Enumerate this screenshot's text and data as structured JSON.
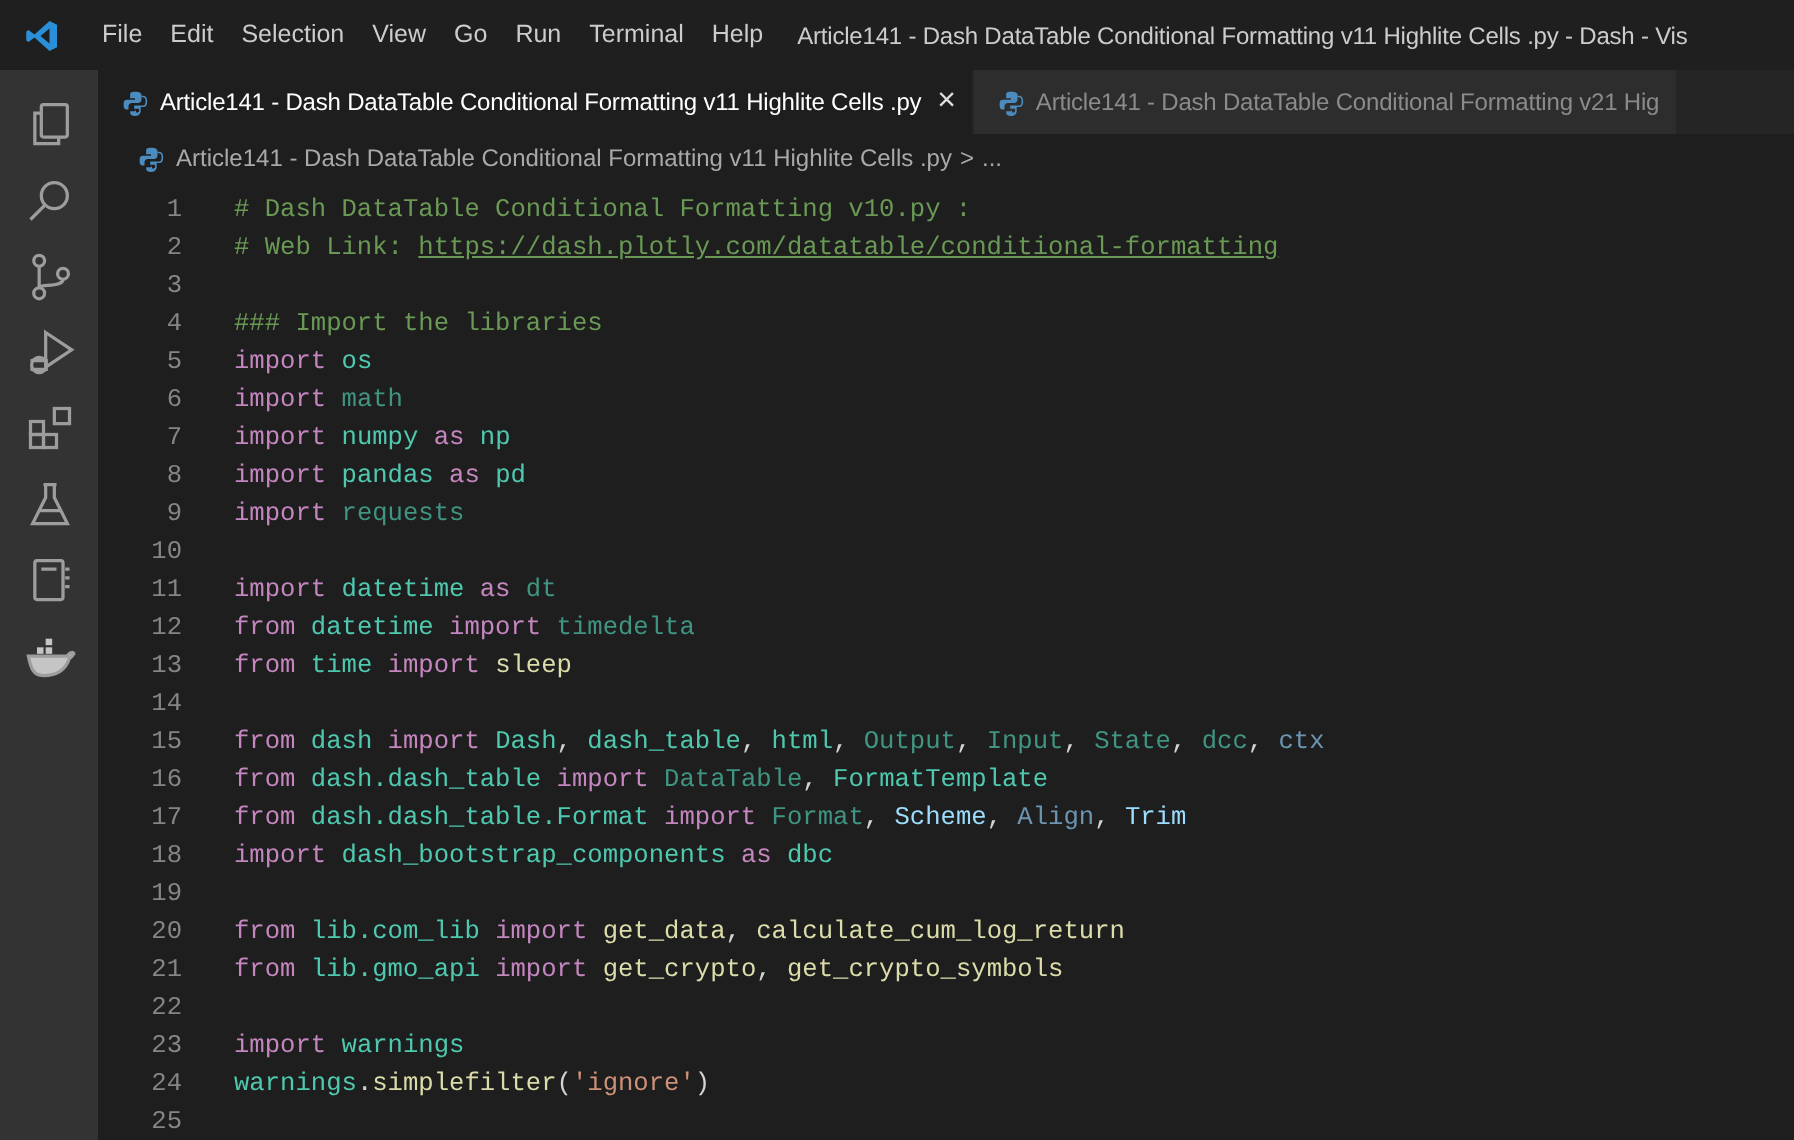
{
  "title_bar": {
    "menu": [
      "File",
      "Edit",
      "Selection",
      "View",
      "Go",
      "Run",
      "Terminal",
      "Help"
    ],
    "title": "Article141 - Dash DataTable Conditional Formatting v11 Highlite Cells .py - Dash - Vis"
  },
  "tabs": [
    {
      "label": "Article141 - Dash DataTable Conditional Formatting v11 Highlite Cells .py",
      "selected": true,
      "close": "×"
    },
    {
      "label": "Article141 - Dash DataTable Conditional Formatting v21 Hig",
      "selected": false
    }
  ],
  "breadcrumb": {
    "file": "Article141 - Dash DataTable Conditional Formatting v11 Highlite Cells .py",
    "separator": ">",
    "more": "..."
  },
  "code": [
    {
      "number": "1",
      "tokens": [
        {
          "kind": "comment",
          "text": "# Dash DataTable Conditional Formatting v10.py :"
        }
      ]
    },
    {
      "number": "2",
      "tokens": [
        {
          "kind": "comment",
          "text": "# Web Link: "
        },
        {
          "kind": "link",
          "text": "https://dash.plotly.com/datatable/conditional-formatting"
        }
      ]
    },
    {
      "number": "3"
    },
    {
      "number": "4",
      "tokens": [
        {
          "kind": "comment",
          "text": "### Import the libraries"
        }
      ]
    },
    {
      "number": "5",
      "tokens": [
        {
          "kind": "keyword",
          "text": "import "
        },
        {
          "kind": "module",
          "text": "os"
        }
      ]
    },
    {
      "number": "6",
      "tokens": [
        {
          "kind": "keyword",
          "text": "import "
        },
        {
          "kind": "dim",
          "text": "math"
        }
      ]
    },
    {
      "number": "7",
      "tokens": [
        {
          "kind": "keyword",
          "text": "import "
        },
        {
          "kind": "module",
          "text": "numpy"
        },
        {
          "kind": "keyword",
          "text": " as "
        },
        {
          "kind": "module",
          "text": "np"
        }
      ]
    },
    {
      "number": "8",
      "tokens": [
        {
          "kind": "keyword",
          "text": "import "
        },
        {
          "kind": "module",
          "text": "pandas"
        },
        {
          "kind": "keyword",
          "text": " as "
        },
        {
          "kind": "module",
          "text": "pd"
        }
      ]
    },
    {
      "number": "9",
      "tokens": [
        {
          "kind": "keyword",
          "text": "import "
        },
        {
          "kind": "dim",
          "text": "requests"
        }
      ]
    },
    {
      "number": "10"
    },
    {
      "number": "11",
      "tokens": [
        {
          "kind": "keyword",
          "text": "import "
        },
        {
          "kind": "module",
          "text": "datetime"
        },
        {
          "kind": "keyword",
          "text": " as "
        },
        {
          "kind": "dim",
          "text": "dt"
        }
      ]
    },
    {
      "number": "12",
      "tokens": [
        {
          "kind": "keyword",
          "text": "from "
        },
        {
          "kind": "module",
          "text": "datetime"
        },
        {
          "kind": "keyword",
          "text": " import "
        },
        {
          "kind": "dim",
          "text": "timedelta"
        }
      ]
    },
    {
      "number": "13",
      "tokens": [
        {
          "kind": "keyword",
          "text": "from "
        },
        {
          "kind": "module",
          "text": "time"
        },
        {
          "kind": "keyword",
          "text": " import "
        },
        {
          "kind": "function",
          "text": "sleep"
        }
      ]
    },
    {
      "number": "14"
    },
    {
      "number": "15",
      "tokens": [
        {
          "kind": "keyword",
          "text": "from "
        },
        {
          "kind": "module",
          "text": "dash"
        },
        {
          "kind": "keyword",
          "text": " import "
        },
        {
          "kind": "module",
          "text": "Dash"
        },
        {
          "kind": "plain",
          "text": ", "
        },
        {
          "kind": "module",
          "text": "dash_table"
        },
        {
          "kind": "plain",
          "text": ", "
        },
        {
          "kind": "module",
          "text": "html"
        },
        {
          "kind": "plain",
          "text": ", "
        },
        {
          "kind": "dim",
          "text": "Output"
        },
        {
          "kind": "plain",
          "text": ", "
        },
        {
          "kind": "dim",
          "text": "Input"
        },
        {
          "kind": "plain",
          "text": ", "
        },
        {
          "kind": "dim",
          "text": "State"
        },
        {
          "kind": "plain",
          "text": ", "
        },
        {
          "kind": "dim",
          "text": "dcc"
        },
        {
          "kind": "plain",
          "text": ", "
        },
        {
          "kind": "dimvar",
          "text": "ctx"
        }
      ]
    },
    {
      "number": "16",
      "tokens": [
        {
          "kind": "keyword",
          "text": "from "
        },
        {
          "kind": "module",
          "text": "dash.dash_table"
        },
        {
          "kind": "keyword",
          "text": " import "
        },
        {
          "kind": "dim",
          "text": "DataTable"
        },
        {
          "kind": "plain",
          "text": ", "
        },
        {
          "kind": "module",
          "text": "FormatTemplate"
        }
      ]
    },
    {
      "number": "17",
      "tokens": [
        {
          "kind": "keyword",
          "text": "from "
        },
        {
          "kind": "module",
          "text": "dash.dash_table.Format"
        },
        {
          "kind": "keyword",
          "text": " import "
        },
        {
          "kind": "dim",
          "text": "Format"
        },
        {
          "kind": "plain",
          "text": ", "
        },
        {
          "kind": "variable",
          "text": "Scheme"
        },
        {
          "kind": "plain",
          "text": ", "
        },
        {
          "kind": "dimvar",
          "text": "Align"
        },
        {
          "kind": "plain",
          "text": ", "
        },
        {
          "kind": "variable",
          "text": "Trim"
        }
      ]
    },
    {
      "number": "18",
      "tokens": [
        {
          "kind": "keyword",
          "text": "import "
        },
        {
          "kind": "module",
          "text": "dash_bootstrap_components"
        },
        {
          "kind": "keyword",
          "text": " as "
        },
        {
          "kind": "module",
          "text": "dbc"
        }
      ]
    },
    {
      "number": "19"
    },
    {
      "number": "20",
      "tokens": [
        {
          "kind": "keyword",
          "text": "from "
        },
        {
          "kind": "module",
          "text": "lib.com_lib"
        },
        {
          "kind": "keyword",
          "text": " import "
        },
        {
          "kind": "function",
          "text": "get_data"
        },
        {
          "kind": "plain",
          "text": ", "
        },
        {
          "kind": "function",
          "text": "calculate_cum_log_return"
        }
      ]
    },
    {
      "number": "21",
      "tokens": [
        {
          "kind": "keyword",
          "text": "from "
        },
        {
          "kind": "module",
          "text": "lib.gmo_api"
        },
        {
          "kind": "keyword",
          "text": " import "
        },
        {
          "kind": "function",
          "text": "get_crypto"
        },
        {
          "kind": "plain",
          "text": ", "
        },
        {
          "kind": "function",
          "text": "get_crypto_symbols"
        }
      ]
    },
    {
      "number": "22"
    },
    {
      "number": "23",
      "tokens": [
        {
          "kind": "keyword",
          "text": "import "
        },
        {
          "kind": "module",
          "text": "warnings"
        }
      ]
    },
    {
      "number": "24",
      "tokens": [
        {
          "kind": "module",
          "text": "warnings"
        },
        {
          "kind": "plain",
          "text": "."
        },
        {
          "kind": "function",
          "text": "simplefilter"
        },
        {
          "kind": "plain",
          "text": "("
        },
        {
          "kind": "string",
          "text": "'ignore'"
        },
        {
          "kind": "plain",
          "text": ")"
        }
      ]
    },
    {
      "number": "25"
    }
  ]
}
